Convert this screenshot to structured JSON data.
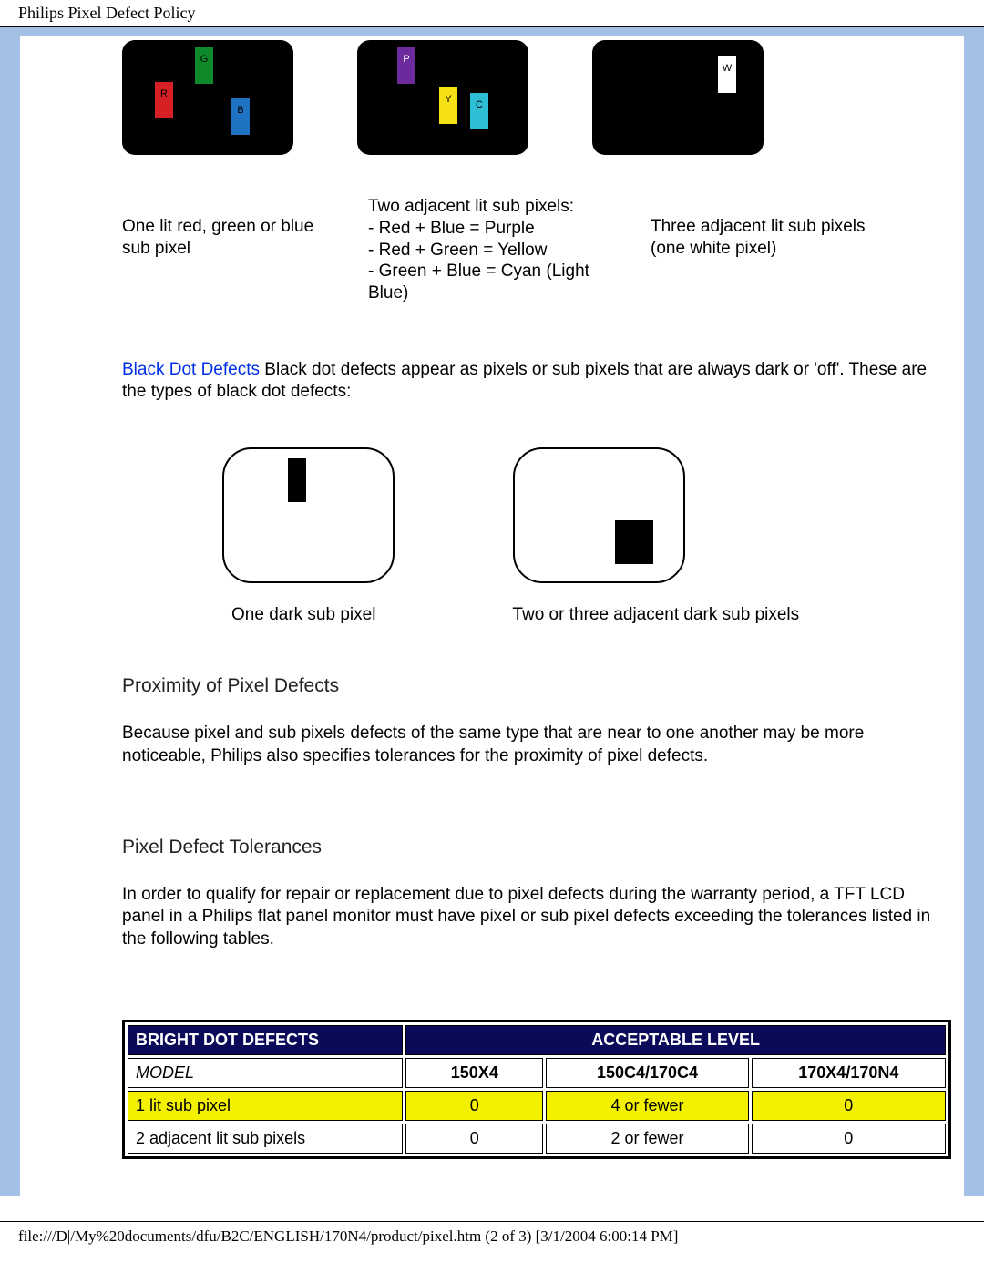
{
  "header": {
    "title": "Philips Pixel Defect Policy"
  },
  "panels": {
    "rgb": {
      "r": "R",
      "g": "G",
      "b": "B"
    },
    "pyc": {
      "p": "P",
      "y": "Y",
      "c": "C"
    },
    "w": {
      "w": "W"
    }
  },
  "captions": {
    "a": "One lit red, green or blue sub pixel",
    "b_line1": "Two adjacent lit sub pixels:",
    "b_line2": "- Red + Blue = Purple",
    "b_line3": "- Red + Green = Yellow",
    "b_line4": "- Green + Blue = Cyan (Light Blue)",
    "c_line1": "Three adjacent lit sub pixels",
    "c_line2": "(one white pixel)"
  },
  "black_dots": {
    "term": "Black Dot Defects",
    "text": " Black dot defects appear as pixels or sub pixels that are always dark or 'off'. These are the types of black dot defects:"
  },
  "white_captions": {
    "a": "One dark sub pixel",
    "b": "Two or three adjacent dark sub pixels"
  },
  "sections": {
    "proximity": {
      "title": "Proximity of Pixel Defects",
      "body": "Because pixel and sub pixels defects of the same type that are near to one another may be more noticeable, Philips also specifies tolerances for the proximity of pixel defects."
    },
    "tolerances": {
      "title": "Pixel Defect Tolerances",
      "body": "In order to qualify for repair or replacement due to pixel defects during the warranty period, a TFT LCD panel in a Philips flat panel monitor must have pixel or sub pixel defects exceeding the tolerances listed in the following tables."
    }
  },
  "table": {
    "head_left": "BRIGHT DOT DEFECTS",
    "head_right": "ACCEPTABLE LEVEL",
    "model_label": "MODEL",
    "models": [
      "150X4",
      "150C4/170C4",
      "170X4/170N4"
    ],
    "rows": [
      {
        "label": "1 lit sub pixel",
        "values": [
          "0",
          "4 or fewer",
          "0"
        ],
        "highlight": true
      },
      {
        "label": "2 adjacent lit sub pixels",
        "values": [
          "0",
          "2 or fewer",
          "0"
        ],
        "highlight": false
      }
    ]
  },
  "footer": {
    "text": "file:///D|/My%20documents/dfu/B2C/ENGLISH/170N4/product/pixel.htm (2 of 3) [3/1/2004 6:00:14 PM]"
  }
}
